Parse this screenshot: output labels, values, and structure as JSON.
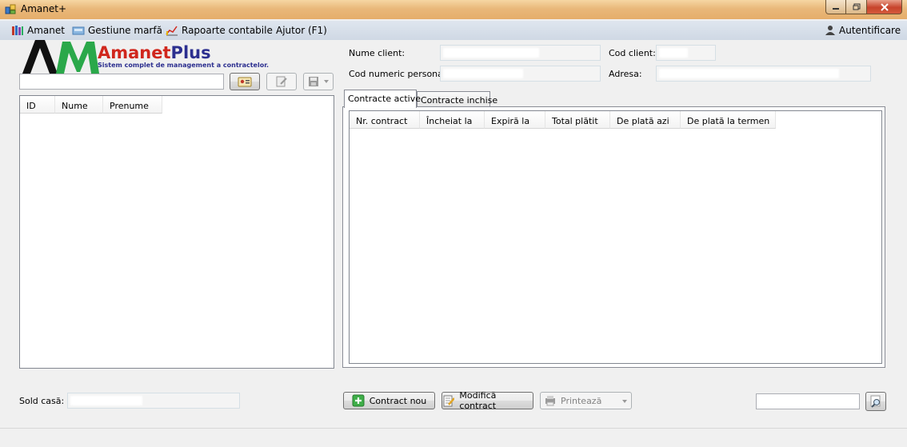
{
  "window": {
    "title": "Amanet+"
  },
  "menu": {
    "amanet": "Amanet",
    "gestiune": "Gestiune marfă",
    "rapoarte": "Rapoarte contabile",
    "ajutor": "Ajutor (F1)",
    "autentificare": "Autentificare"
  },
  "logo": {
    "brand_amanet": "Amanet",
    "brand_plus": "Plus",
    "tagline": "Sistem complet de management a contractelor."
  },
  "clients": {
    "search_value": "",
    "columns": [
      "ID",
      "Nume",
      "Prenume"
    ]
  },
  "client_info": {
    "nume_label": "Nume client:",
    "cod_client_label": "Cod client:",
    "cnp_label": "Cod numeric personal:",
    "adresa_label": "Adresa:"
  },
  "tabs": {
    "active": "Contracte active",
    "closed": "Contracte inchise"
  },
  "contracts": {
    "columns": [
      "Nr. contract",
      "Încheiat la",
      "Expiră la",
      "Total plătit",
      "De plată azi",
      "De plată la termen"
    ]
  },
  "footer": {
    "sold_label": "Sold casă:",
    "contract_nou": "Contract nou",
    "modifica": "Modifică contract",
    "printeaza": "Printează",
    "search_value": ""
  },
  "colors": {
    "title_bar": "#e9b87a",
    "menu_bar": "#d6dee9",
    "brand_green": "#2aa84a",
    "brand_blue": "#2c2f8f",
    "logo_red": "#d0271d"
  }
}
